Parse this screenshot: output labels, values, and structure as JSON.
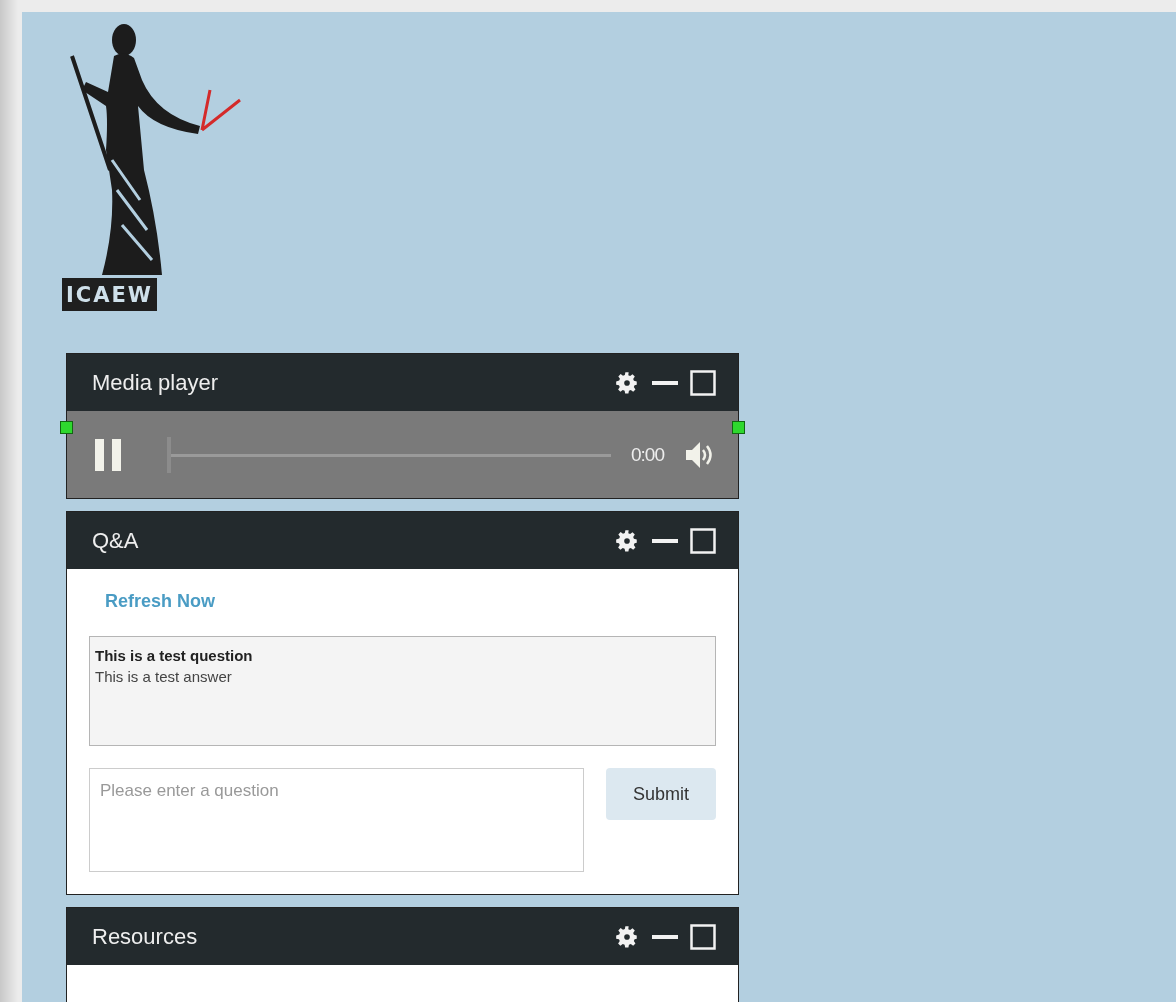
{
  "logo": {
    "text": "ICAEW"
  },
  "panels": [
    {
      "kind": "media",
      "title": "Media player",
      "playing": true,
      "level": 0,
      "time": "0:00"
    },
    {
      "kind": "qa",
      "title": "Q&A",
      "refresh": "Refresh Now",
      "items": [
        {
          "question": "This is a test question",
          "answer": "This is a test answer"
        }
      ],
      "input": {
        "placeholder": "Please enter a question"
      },
      "submit": "Submit"
    },
    {
      "kind": "resources",
      "title": "Resources"
    }
  ]
}
